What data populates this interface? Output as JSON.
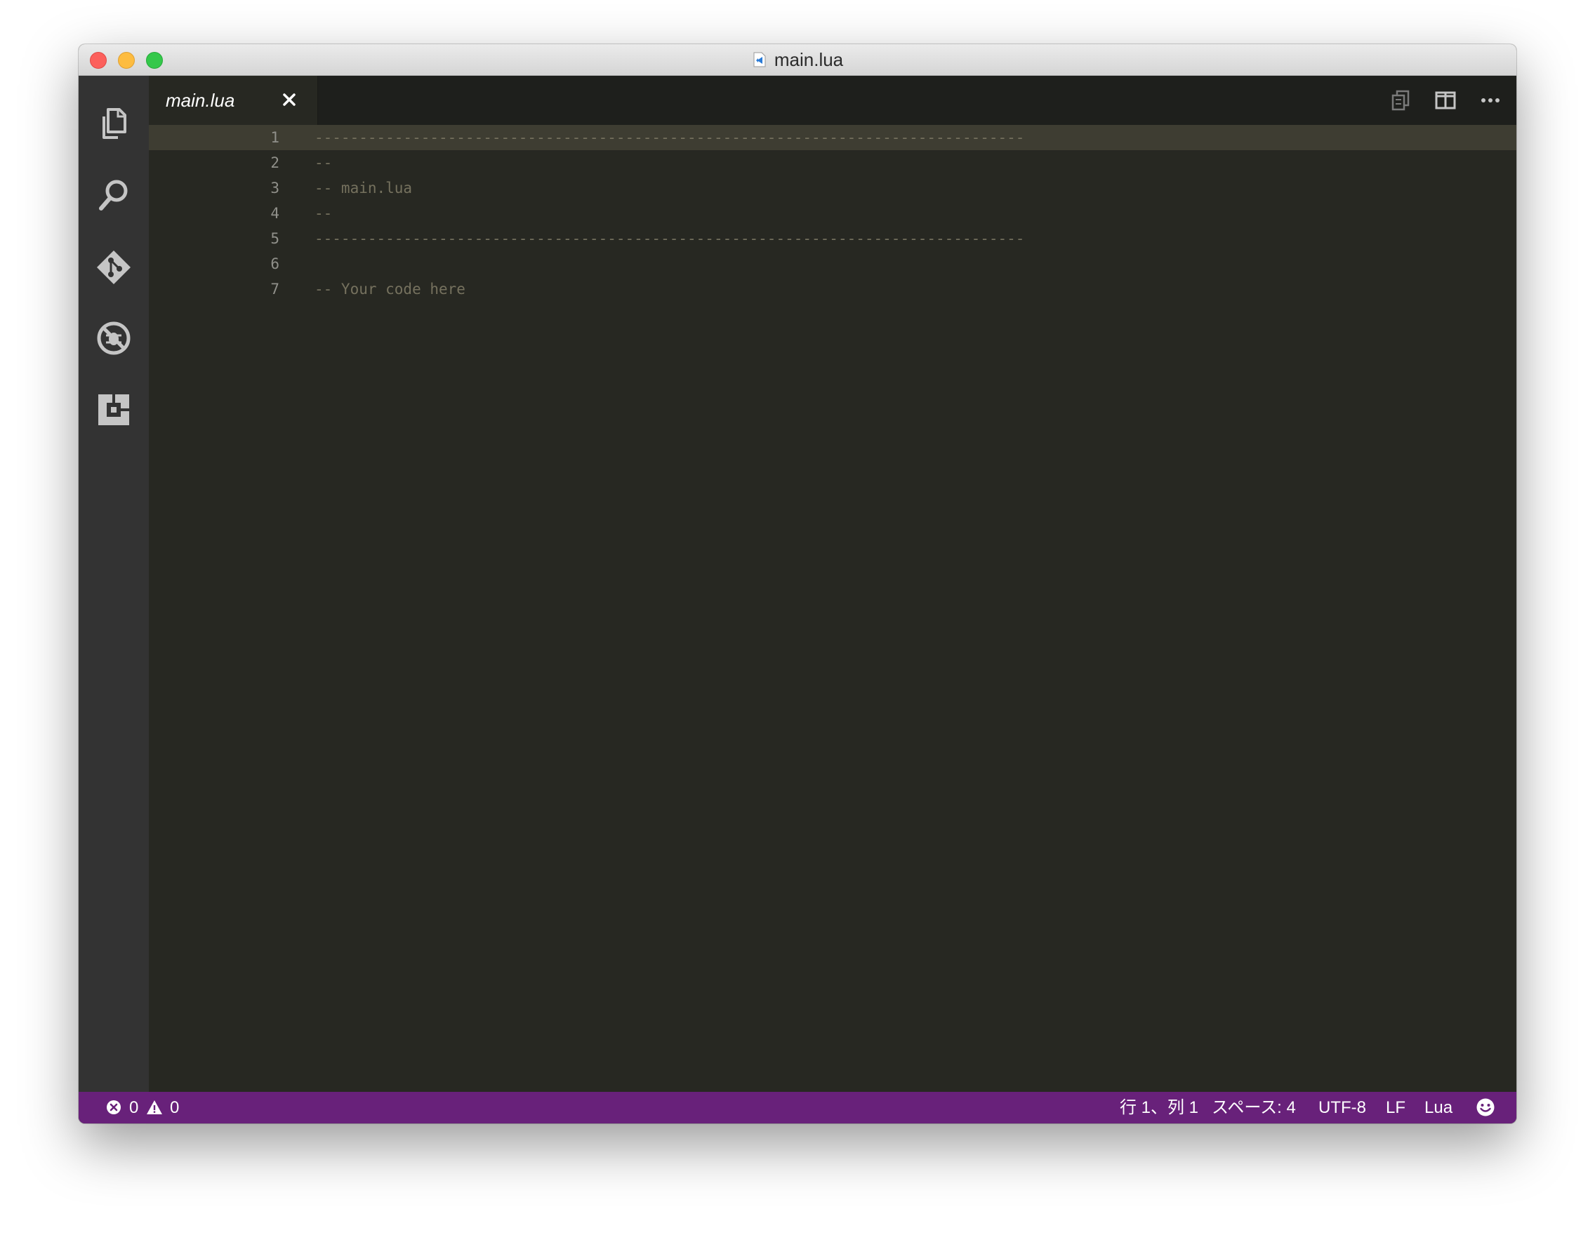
{
  "window": {
    "title": "main.lua"
  },
  "editor": {
    "tabs": [
      {
        "label": "main.lua",
        "active": true
      }
    ],
    "lines": [
      {
        "number": "1",
        "text": "--------------------------------------------------------------------------------"
      },
      {
        "number": "2",
        "text": "--"
      },
      {
        "number": "3",
        "text": "-- main.lua"
      },
      {
        "number": "4",
        "text": "--"
      },
      {
        "number": "5",
        "text": "--------------------------------------------------------------------------------"
      },
      {
        "number": "6",
        "text": ""
      },
      {
        "number": "7",
        "text": "-- Your code here"
      }
    ]
  },
  "activitybar": {
    "icons": [
      "explorer-icon",
      "search-icon",
      "git-icon",
      "debug-icon",
      "extensions-icon"
    ]
  },
  "statusbar": {
    "errors": "0",
    "warnings": "0",
    "position": "行 1、列 1",
    "indent": "スペース: 4",
    "encoding": "UTF-8",
    "eol": "LF",
    "language": "Lua",
    "feedback_icon": "smiley-icon"
  },
  "colors": {
    "statusbar_bg": "#68217a",
    "editor_bg": "#272822",
    "comment": "#75715e",
    "line_number": "#90908a",
    "current_line": "#3e3d32",
    "activitybar_bg": "#333333"
  }
}
